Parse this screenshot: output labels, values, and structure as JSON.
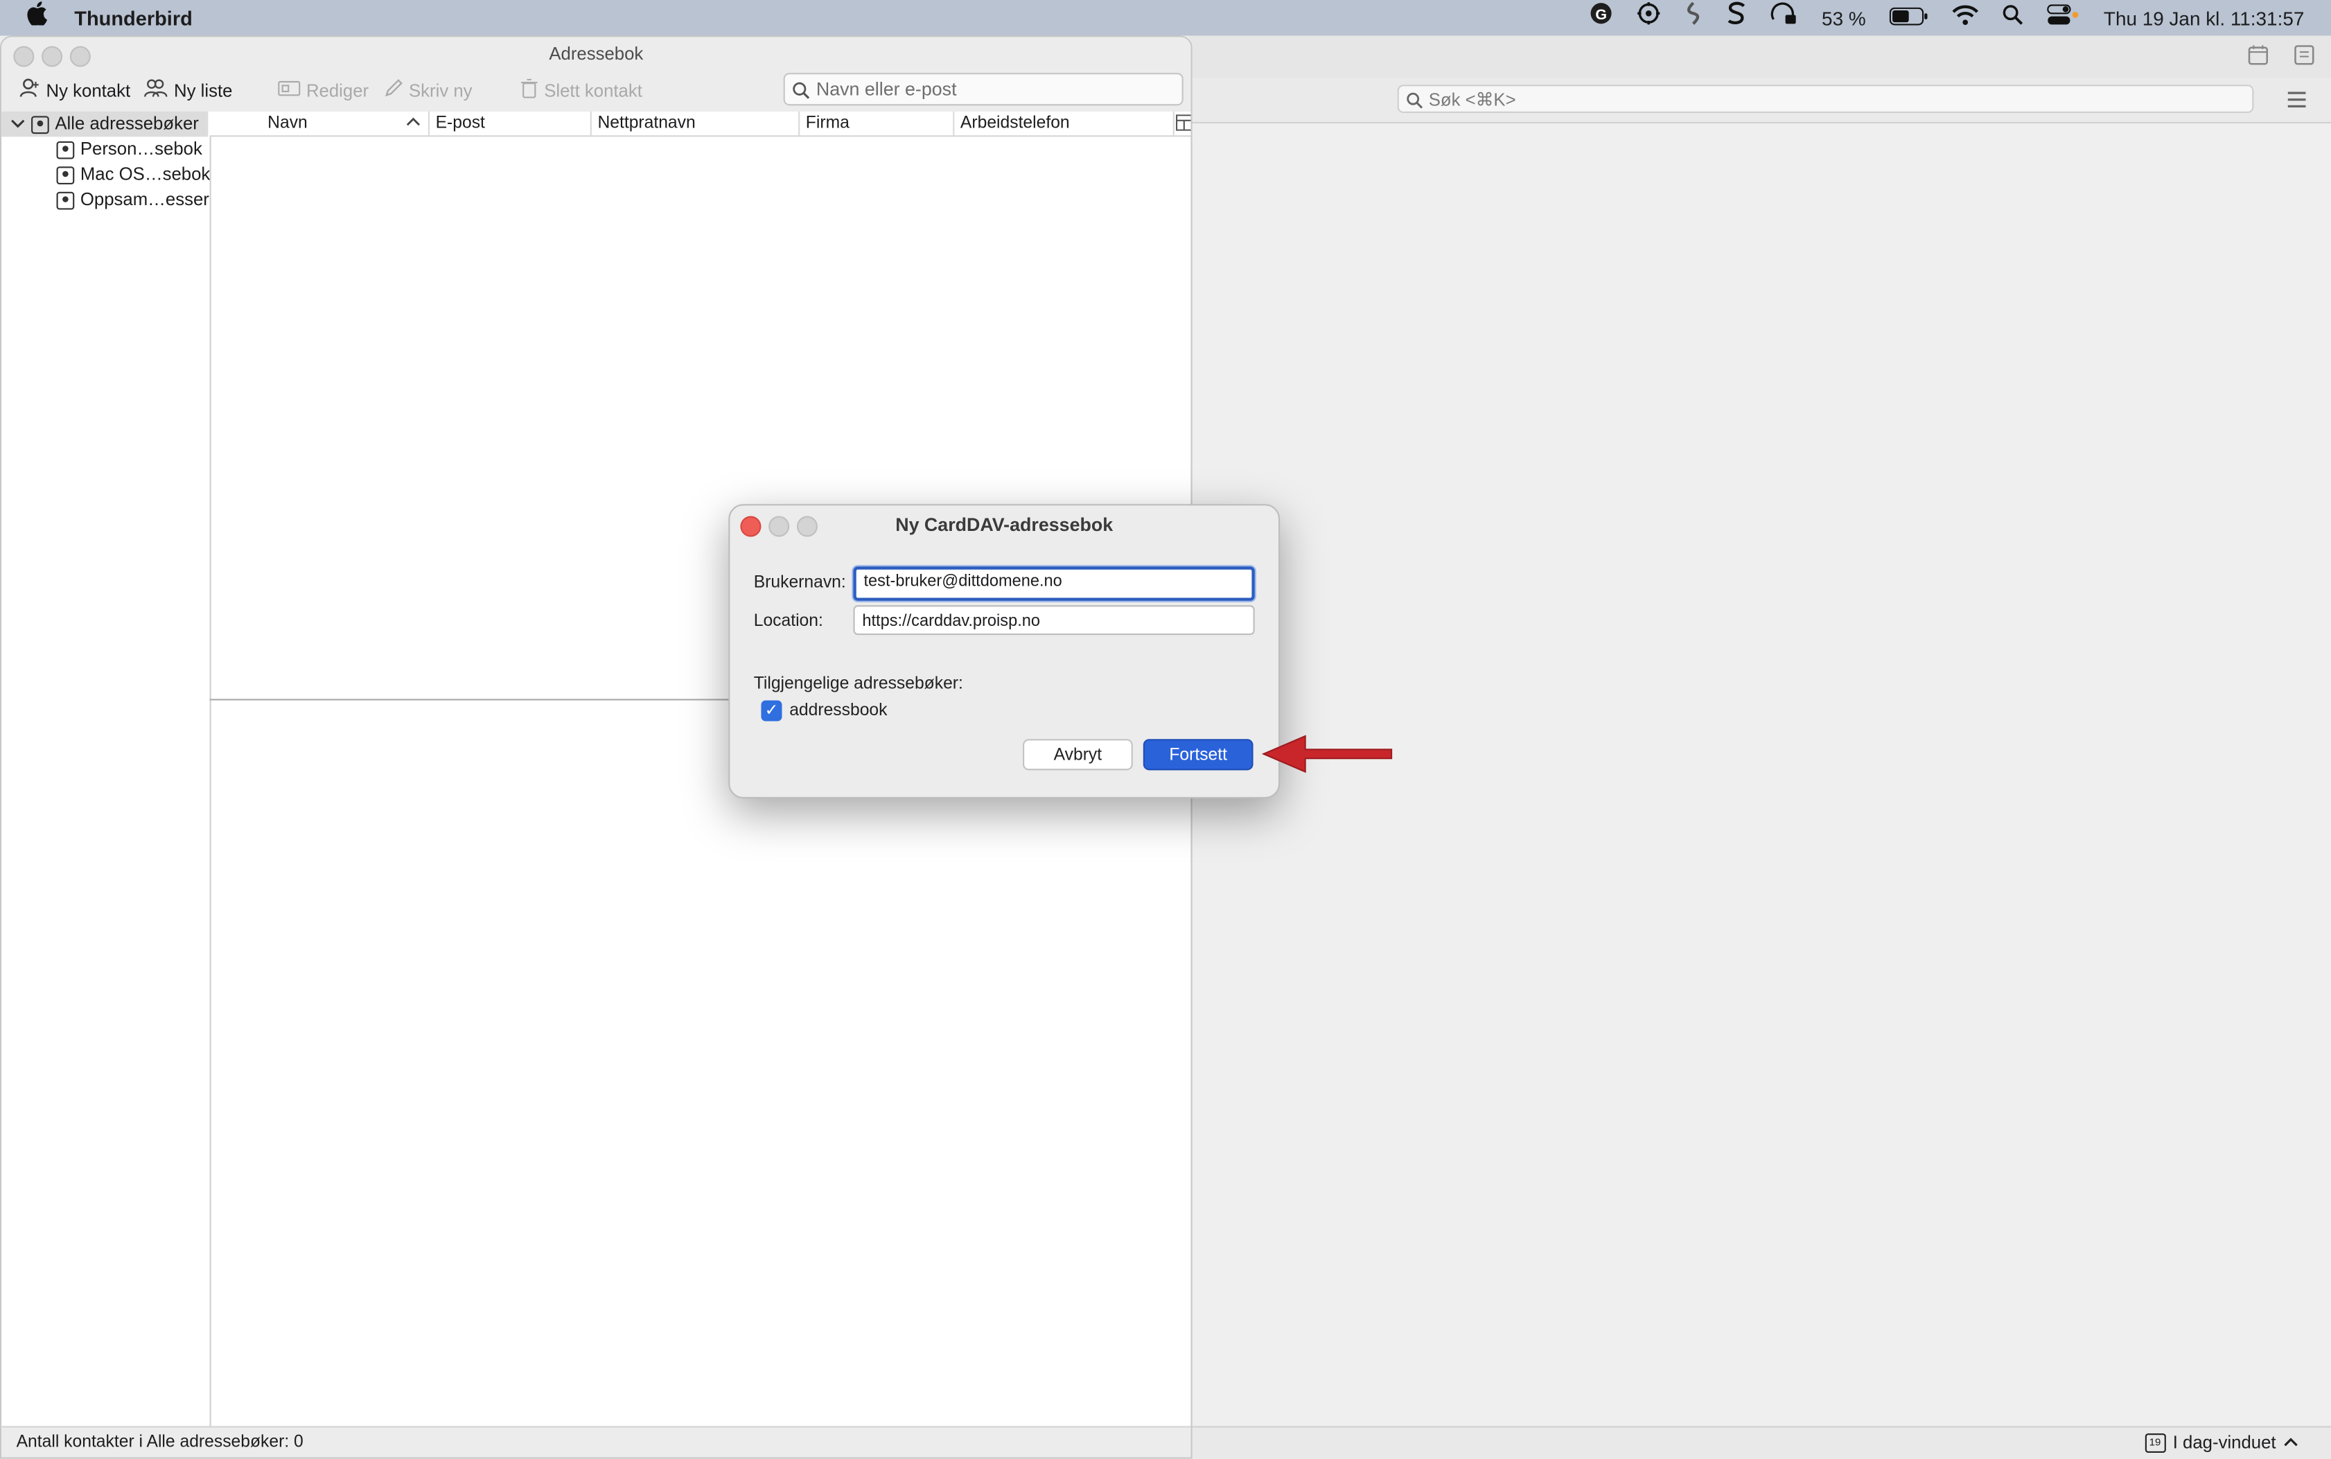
{
  "menubar": {
    "app_name": "Thunderbird",
    "battery": "53 %",
    "clock": "Thu 19 Jan kl. 11:31:57"
  },
  "addressbook": {
    "window_title": "Adressebok",
    "toolbar": {
      "new_contact": "Ny kontakt",
      "new_list": "Ny liste",
      "edit": "Rediger",
      "write": "Skriv ny",
      "delete": "Slett kontakt"
    },
    "search_placeholder": "Navn eller e-post",
    "sidebar": {
      "root": "Alle adressebøker",
      "items": [
        "Person…sebok",
        "Mac OS…sebok",
        "Oppsam…esser"
      ]
    },
    "columns": [
      "Navn",
      "E-post",
      "Nettpratnavn",
      "Firma",
      "Arbeidstelefon"
    ],
    "status": "Antall kontakter i Alle adressebøker: 0"
  },
  "mainwindow": {
    "search_placeholder": "Søk <⌘K>",
    "today_pane": "I dag-vinduet",
    "calendar_day": "19"
  },
  "dialog": {
    "title": "Ny CardDAV-adressebok",
    "username_label": "Brukernavn:",
    "username_value": "test-bruker@dittdomene.no",
    "location_label": "Location:",
    "location_value": "https://carddav.proisp.no",
    "available_label": "Tilgjengelige adressebøker:",
    "book_name": "addressbook",
    "cancel": "Avbryt",
    "continue": "Fortsett"
  },
  "colors": {
    "accent": "#2a62da",
    "arrow": "#c8262b",
    "close_red": "#ee5e57"
  }
}
